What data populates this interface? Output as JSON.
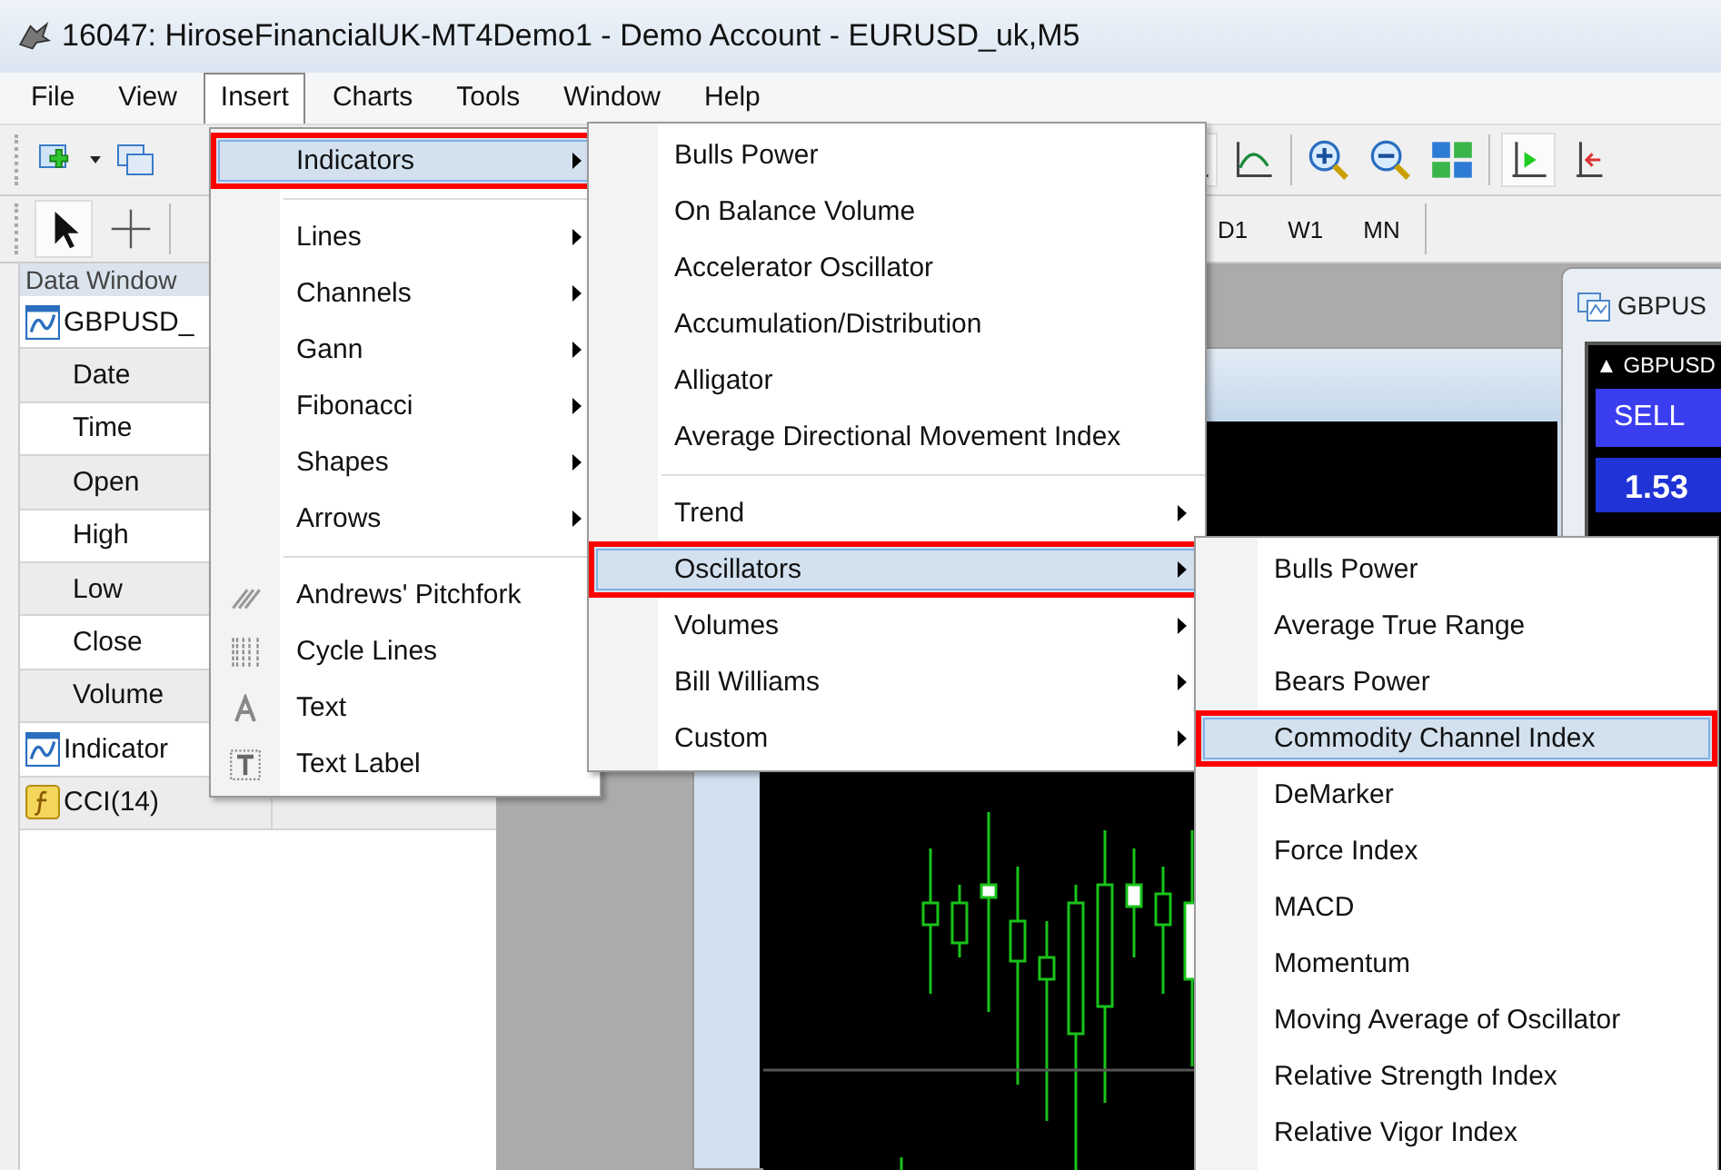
{
  "window": {
    "title": "16047: HiroseFinancialUK-MT4Demo1 - Demo Account - EURUSD_uk,M5"
  },
  "menu_bar": [
    {
      "label": "File",
      "selected": false
    },
    {
      "label": "View",
      "selected": false
    },
    {
      "label": "Insert",
      "selected": true
    },
    {
      "label": "Charts",
      "selected": false
    },
    {
      "label": "Tools",
      "selected": false
    },
    {
      "label": "Window",
      "selected": false
    },
    {
      "label": "Help",
      "selected": false
    }
  ],
  "timeframes": [
    "D1",
    "W1",
    "MN"
  ],
  "data_window": {
    "title": "Data Window",
    "rows": [
      {
        "kind": "symbol",
        "label": "GBPUSD_"
      },
      {
        "kind": "field",
        "label": "Date"
      },
      {
        "kind": "field",
        "label": "Time"
      },
      {
        "kind": "field",
        "label": "Open"
      },
      {
        "kind": "field",
        "label": "High"
      },
      {
        "kind": "field",
        "label": "Low"
      },
      {
        "kind": "field",
        "label": "Close"
      },
      {
        "kind": "field",
        "label": "Volume"
      },
      {
        "kind": "symbol",
        "label": "Indicator"
      },
      {
        "kind": "indicator",
        "label": "CCI(14)"
      }
    ]
  },
  "chart_windows": [
    {
      "title": "GBPUS",
      "trade_panel": {
        "symbol": "▲ GBPUSD",
        "sell": "SELL",
        "price": "1.53"
      }
    }
  ],
  "insert_menu": [
    {
      "kind": "submenu",
      "label": "Indicators",
      "selected": true
    },
    {
      "kind": "separator"
    },
    {
      "kind": "submenu",
      "label": "Lines",
      "selected": false
    },
    {
      "kind": "submenu",
      "label": "Channels",
      "selected": false
    },
    {
      "kind": "submenu",
      "label": "Gann",
      "selected": false
    },
    {
      "kind": "submenu",
      "label": "Fibonacci",
      "selected": false
    },
    {
      "kind": "submenu",
      "label": "Shapes",
      "selected": false
    },
    {
      "kind": "submenu",
      "label": "Arrows",
      "selected": false
    },
    {
      "kind": "separator"
    },
    {
      "kind": "tool",
      "label": "Andrews' Pitchfork",
      "selected": false
    },
    {
      "kind": "tool",
      "label": "Cycle Lines",
      "selected": false
    },
    {
      "kind": "tool",
      "label": "Text",
      "selected": false
    },
    {
      "kind": "tool",
      "label": "Text Label",
      "selected": false
    }
  ],
  "indicators_menu": [
    {
      "kind": "item",
      "label": "Bulls Power",
      "selected": false
    },
    {
      "kind": "item",
      "label": "On Balance Volume",
      "selected": false
    },
    {
      "kind": "item",
      "label": "Accelerator Oscillator",
      "selected": false
    },
    {
      "kind": "item",
      "label": "Accumulation/Distribution",
      "selected": false
    },
    {
      "kind": "item",
      "label": "Alligator",
      "selected": false
    },
    {
      "kind": "item",
      "label": "Average Directional Movement Index",
      "selected": false
    },
    {
      "kind": "separator"
    },
    {
      "kind": "submenu",
      "label": "Trend",
      "selected": false
    },
    {
      "kind": "submenu",
      "label": "Oscillators",
      "selected": true
    },
    {
      "kind": "submenu",
      "label": "Volumes",
      "selected": false
    },
    {
      "kind": "submenu",
      "label": "Bill Williams",
      "selected": false
    },
    {
      "kind": "submenu",
      "label": "Custom",
      "selected": false
    }
  ],
  "oscillators_menu": [
    {
      "kind": "item",
      "label": "Bulls Power",
      "selected": false
    },
    {
      "kind": "item",
      "label": "Average True Range",
      "selected": false
    },
    {
      "kind": "item",
      "label": "Bears Power",
      "selected": false
    },
    {
      "kind": "item",
      "label": "Commodity Channel Index",
      "selected": true
    },
    {
      "kind": "item",
      "label": "DeMarker",
      "selected": false
    },
    {
      "kind": "item",
      "label": "Force Index",
      "selected": false
    },
    {
      "kind": "item",
      "label": "MACD",
      "selected": false
    },
    {
      "kind": "item",
      "label": "Momentum",
      "selected": false
    },
    {
      "kind": "item",
      "label": "Moving Average of Oscillator",
      "selected": false
    },
    {
      "kind": "item",
      "label": "Relative Strength Index",
      "selected": false
    },
    {
      "kind": "item",
      "label": "Relative Vigor Index",
      "selected": false
    }
  ]
}
